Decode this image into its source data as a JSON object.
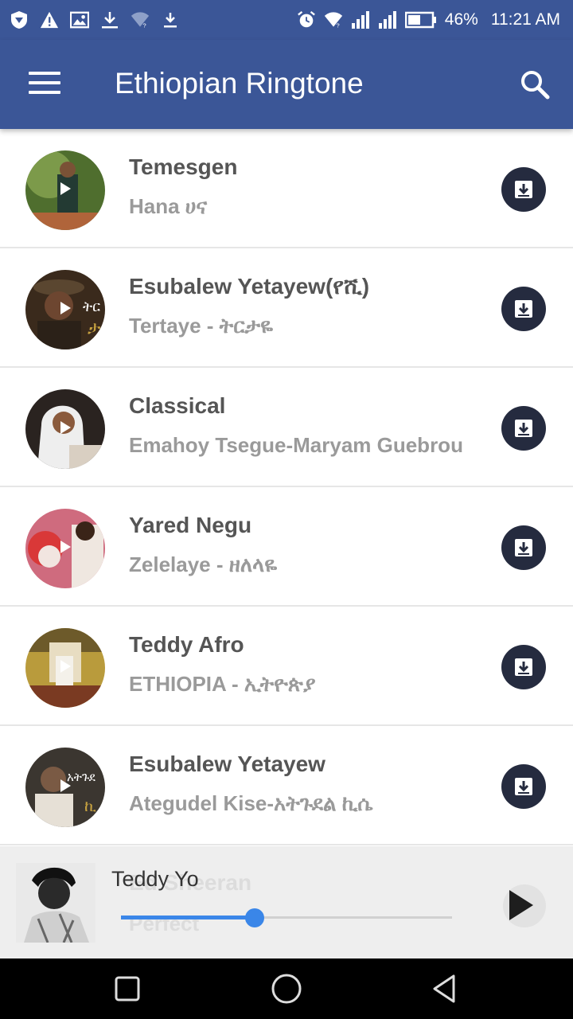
{
  "status_bar": {
    "battery": "46%",
    "time": "11:21 AM",
    "left_icons": [
      "shield-icon",
      "warning-icon",
      "image-icon",
      "download-icon",
      "wifi-question-icon",
      "download-small-icon"
    ],
    "right_icons": [
      "alarm-icon",
      "wifi-icon",
      "signal-icon",
      "signal-icon",
      "battery-icon"
    ]
  },
  "app_bar": {
    "title": "Ethiopian Ringtone",
    "menu_icon": "menu-icon",
    "search_icon": "search-icon",
    "color": "#3b5697"
  },
  "songs": [
    {
      "title": "Temesgen",
      "subtitle": "Hana  ሀና"
    },
    {
      "title": "Esubalew Yetayew(የሺ)",
      "subtitle": "Tertaye - ትርታዬ"
    },
    {
      "title": "Classical",
      "subtitle": "Emahoy Tsegue-Maryam Guebrou"
    },
    {
      "title": "Yared Negu",
      "subtitle": "Zelelaye - ዘለላዬ"
    },
    {
      "title": "Teddy Afro",
      "subtitle": "ETHIOPIA - ኢትዮጵያ"
    },
    {
      "title": "Esubalew Yetayew",
      "subtitle": "Ategudel Kise-አትጉደል ኪሴ"
    }
  ],
  "partial_song": {
    "title": "Ed Sheeran",
    "subtitle": "Perfect"
  },
  "player": {
    "now_playing": "Teddy Yo",
    "progress": 0.405,
    "accent": "#3a86e8"
  },
  "nav": {
    "icons": [
      "recents-icon",
      "home-icon",
      "back-icon"
    ]
  }
}
